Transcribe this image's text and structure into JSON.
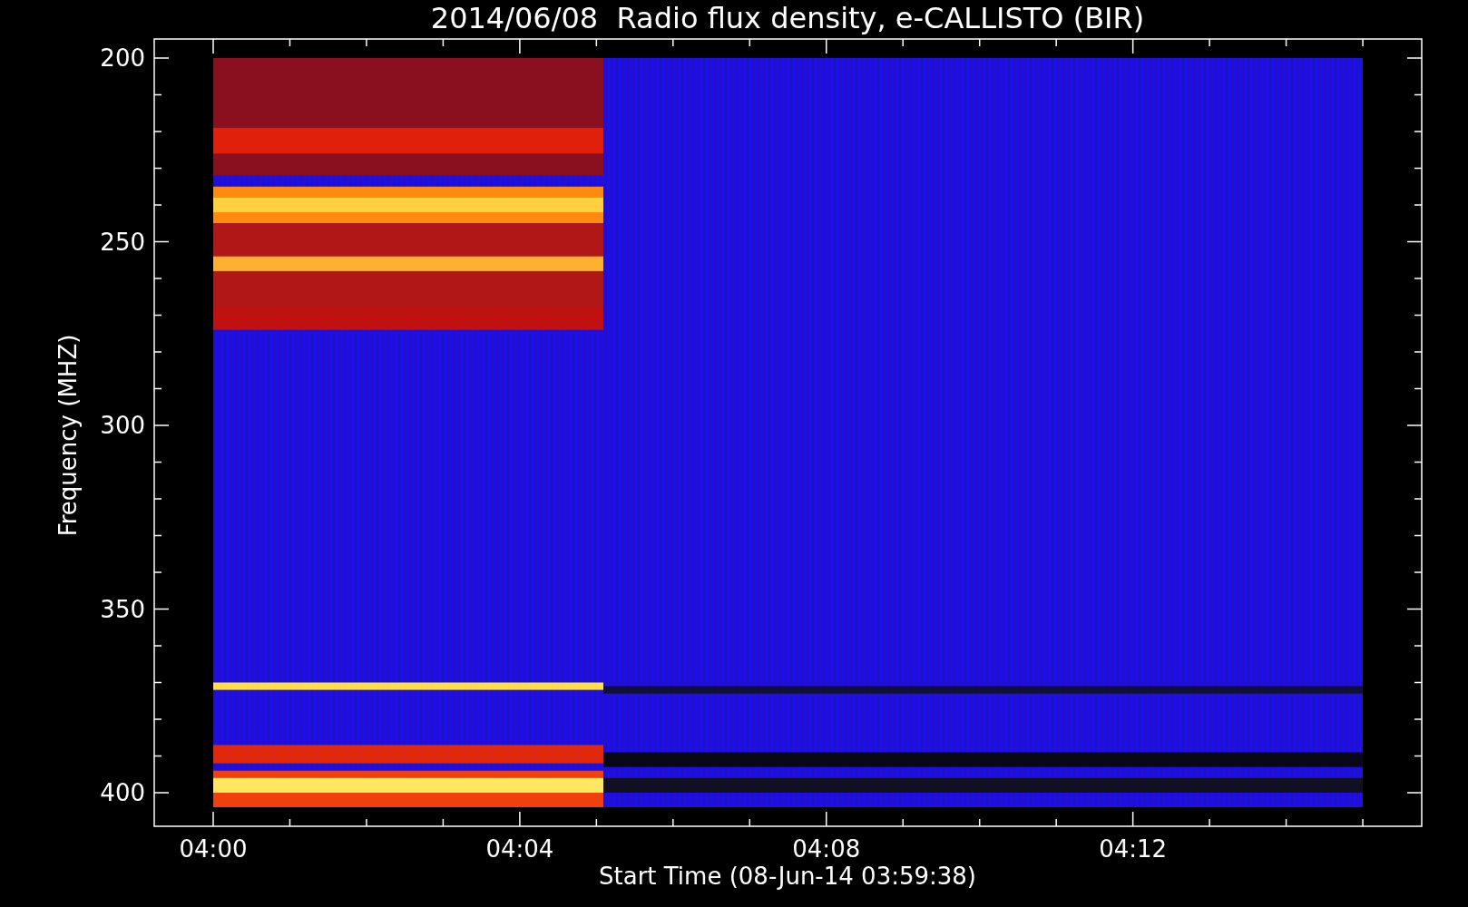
{
  "title": "2014/06/08  Radio flux density, e-CALLISTO (BIR)",
  "y_axis": {
    "label": "Frequency (MHZ)",
    "ticks": [
      "200",
      "250",
      "300",
      "350",
      "400"
    ]
  },
  "x_axis": {
    "label": "Start Time (08-Jun-14 03:59:38)",
    "ticks": [
      "04:00",
      "04:04",
      "04:08",
      "04:12"
    ]
  }
}
